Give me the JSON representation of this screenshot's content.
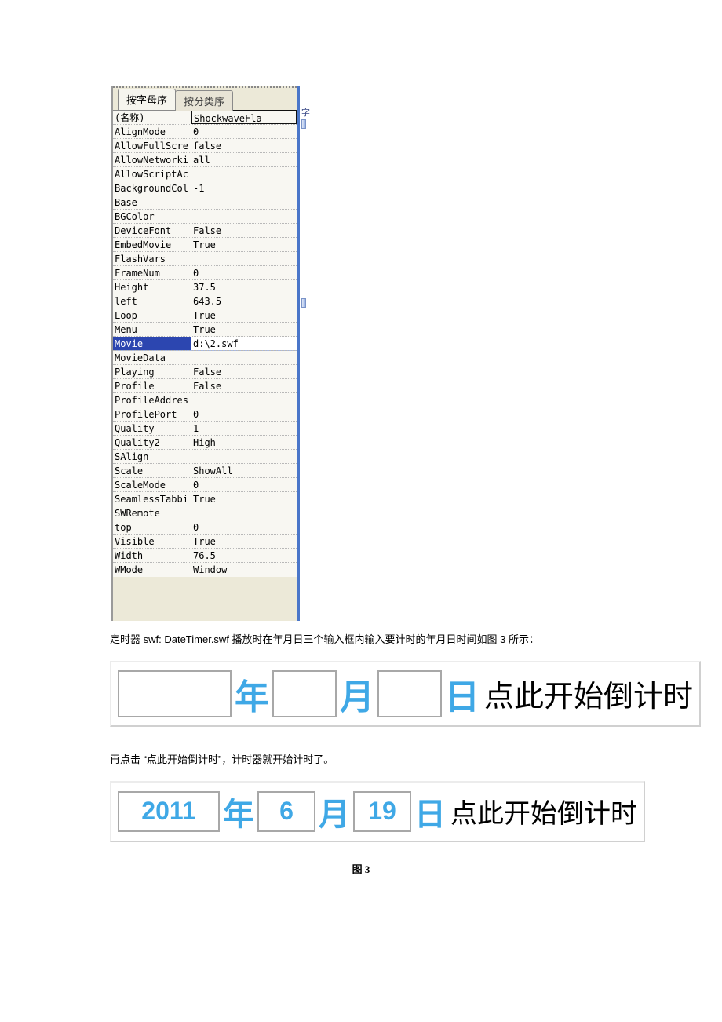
{
  "tabs": {
    "active": "按字母序",
    "inactive": "按分类序"
  },
  "sideGlyph": "字",
  "properties": [
    {
      "name": "(名称)",
      "value": "ShockwaveFla"
    },
    {
      "name": "AlignMode",
      "value": "0"
    },
    {
      "name": "AllowFullScre",
      "value": "false"
    },
    {
      "name": "AllowNetworki",
      "value": "all"
    },
    {
      "name": "AllowScriptAc",
      "value": ""
    },
    {
      "name": "BackgroundCol",
      "value": "-1"
    },
    {
      "name": "Base",
      "value": ""
    },
    {
      "name": "BGColor",
      "value": ""
    },
    {
      "name": "DeviceFont",
      "value": "False"
    },
    {
      "name": "EmbedMovie",
      "value": "True"
    },
    {
      "name": "FlashVars",
      "value": ""
    },
    {
      "name": "FrameNum",
      "value": "0"
    },
    {
      "name": "Height",
      "value": "37.5"
    },
    {
      "name": "left",
      "value": "643.5"
    },
    {
      "name": "Loop",
      "value": "True"
    },
    {
      "name": "Menu",
      "value": "True"
    },
    {
      "name": "Movie",
      "value": "d:\\2.swf"
    },
    {
      "name": "MovieData",
      "value": ""
    },
    {
      "name": "Playing",
      "value": "False"
    },
    {
      "name": "Profile",
      "value": "False"
    },
    {
      "name": "ProfileAddres",
      "value": ""
    },
    {
      "name": "ProfilePort",
      "value": "0"
    },
    {
      "name": "Quality",
      "value": "1"
    },
    {
      "name": "Quality2",
      "value": "High"
    },
    {
      "name": "SAlign",
      "value": ""
    },
    {
      "name": "Scale",
      "value": "ShowAll"
    },
    {
      "name": "ScaleMode",
      "value": "0"
    },
    {
      "name": "SeamlessTabbi",
      "value": "True"
    },
    {
      "name": "SWRemote",
      "value": ""
    },
    {
      "name": "top",
      "value": "0"
    },
    {
      "name": "Visible",
      "value": "True"
    },
    {
      "name": "Width",
      "value": "76.5"
    },
    {
      "name": "WMode",
      "value": "Window"
    }
  ],
  "selectedProperty": "Movie",
  "para1": "定时器 swf: DateTimer.swf 播放时在年月日三个输入框内输入要计时的年月日时间如图 3 所示：",
  "para2": "再点击 “点此开始倒计时”，计时器就开始计时了。",
  "labels": {
    "year": "年",
    "month": "月",
    "day": "日",
    "tail": "点此开始倒计时"
  },
  "empty": {
    "year": "",
    "month": "",
    "day": ""
  },
  "filled": {
    "year": "2011",
    "month": "6",
    "day": "19"
  },
  "caption": "图 3"
}
